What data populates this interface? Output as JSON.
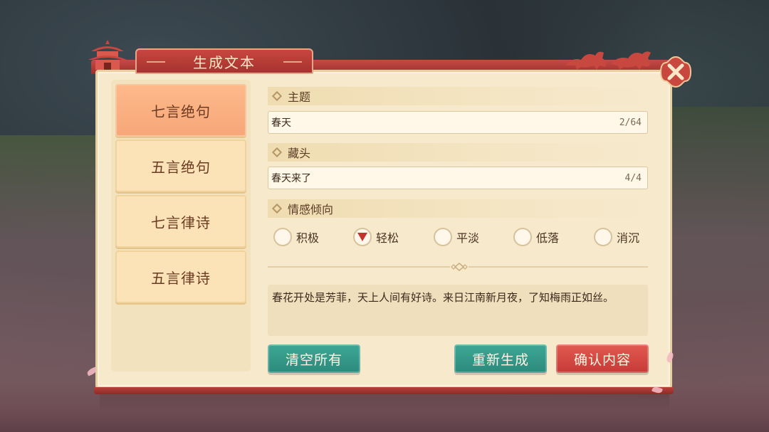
{
  "dialog": {
    "title": "生成文本",
    "close_icon": "close-icon"
  },
  "sidebar": {
    "items": [
      {
        "label": "七言绝句",
        "active": true
      },
      {
        "label": "五言绝句",
        "active": false
      },
      {
        "label": "七言律诗",
        "active": false
      },
      {
        "label": "五言律诗",
        "active": false
      }
    ]
  },
  "topic": {
    "label": "主题",
    "value": "春天",
    "count": "2/64"
  },
  "acrostic": {
    "label": "藏头",
    "value": "春天来了",
    "count": "4/4"
  },
  "sentiment": {
    "label": "情感倾向",
    "options": [
      {
        "label": "积极",
        "selected": false
      },
      {
        "label": "轻松",
        "selected": true
      },
      {
        "label": "平淡",
        "selected": false
      },
      {
        "label": "低落",
        "selected": false
      },
      {
        "label": "消沉",
        "selected": false
      }
    ]
  },
  "output": {
    "text": "春花开处是芳菲，天上人间有好诗。来日江南新月夜，了知梅雨正如丝。"
  },
  "buttons": {
    "clear_all": "清空所有",
    "regenerate": "重新生成",
    "confirm": "确认内容"
  },
  "colors": {
    "accent_red": "#c63a37",
    "teal": "#2b8a7c",
    "panel_bg": "#f6e9cc",
    "active_tab": "#f7a779"
  }
}
